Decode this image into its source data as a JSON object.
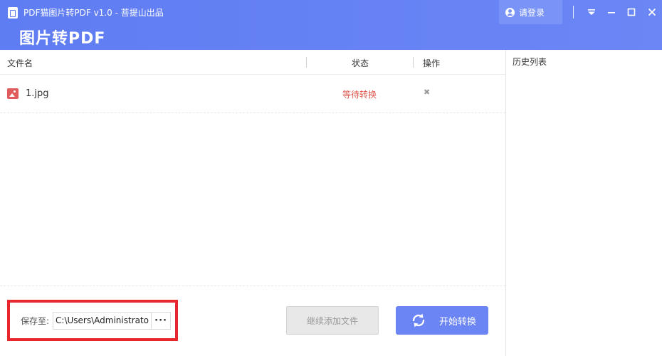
{
  "titlebar": {
    "window_title": "PDF猫图片转PDF v1.0 - 菩提山出品",
    "app_heading": "图片转PDF",
    "login_label": "请登录",
    "menu_glyph": "⏷",
    "minimize_glyph": "—",
    "maximize_glyph": "☐",
    "close_glyph": "✕"
  },
  "table": {
    "headers": {
      "name": "文件名",
      "status": "状态",
      "action": "操作"
    },
    "rows": [
      {
        "file_name": "1.jpg",
        "status": "等待转换",
        "remove_glyph": "✖"
      }
    ]
  },
  "bottom": {
    "save_label": "保存至:",
    "save_path": "C:\\Users\\Administrator",
    "browse_label": "···",
    "add_files_label": "继续添加文件",
    "start_label": "开始转换"
  },
  "history": {
    "title": "历史列表"
  },
  "colors": {
    "brand": "#5f7df2",
    "status_waiting": "#e0574f",
    "highlight": "#e8262e"
  }
}
